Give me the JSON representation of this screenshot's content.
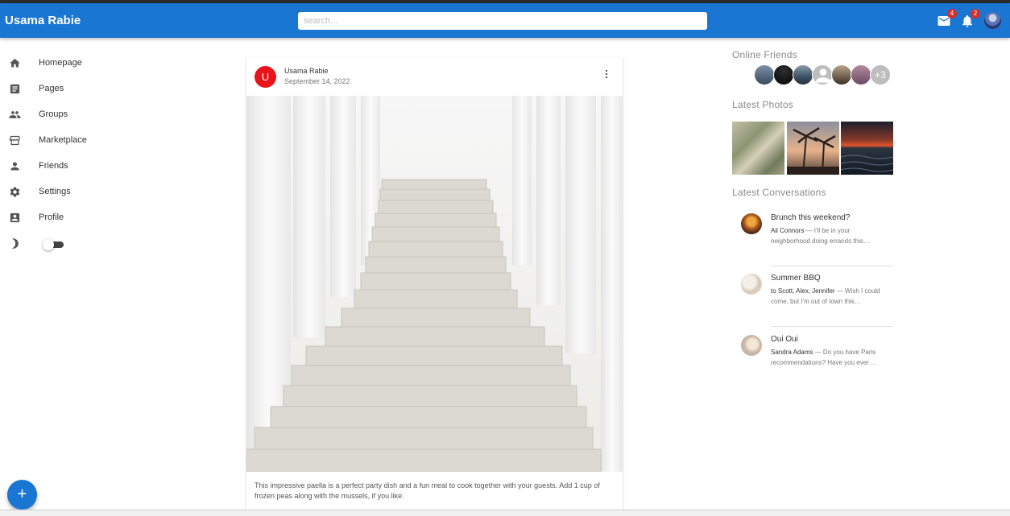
{
  "appbar": {
    "title": "Usama Rabie",
    "search_placeholder": "search...",
    "mail_count": "4",
    "notification_count": "2"
  },
  "sidebar": {
    "items": [
      {
        "label": "Homepage",
        "icon": "home-icon"
      },
      {
        "label": "Pages",
        "icon": "article-icon"
      },
      {
        "label": "Groups",
        "icon": "group-icon"
      },
      {
        "label": "Marketplace",
        "icon": "storefront-icon"
      },
      {
        "label": "Friends",
        "icon": "person-icon"
      },
      {
        "label": "Settings",
        "icon": "gear-icon"
      },
      {
        "label": "Profile",
        "icon": "account-box-icon"
      }
    ],
    "dark_mode_icon": "moon-icon",
    "dark_mode_on": false
  },
  "post": {
    "avatar_letter": "U",
    "author": "Usama Rabie",
    "date": "September 14, 2022",
    "text": "This impressive paella is a perfect party dish and a fun meal to cook together with your guests. Add 1 cup of frozen peas along with the mussels, if you like."
  },
  "right": {
    "online_title": "Online Friends",
    "online_more": "+3",
    "photos_title": "Latest Photos",
    "conversations_title": "Latest Conversations",
    "conversations": [
      {
        "title": "Brunch this weekend?",
        "who": "Ali Connors",
        "message": " — I'll be in your neighborhood doing errands this…"
      },
      {
        "title": "Summer BBQ",
        "who": "to Scott, Alex, Jennifer",
        "message": " — Wish I could come, but I'm out of town this…"
      },
      {
        "title": "Oui Oui",
        "who": "Sandra Adams",
        "message": " — Do you have Paris recommendations? Have you ever…"
      }
    ]
  },
  "fab": {
    "label": "+"
  },
  "colors": {
    "primary": "#1976d2",
    "badge": "#d32f2f",
    "avatar": "#e8141a"
  }
}
